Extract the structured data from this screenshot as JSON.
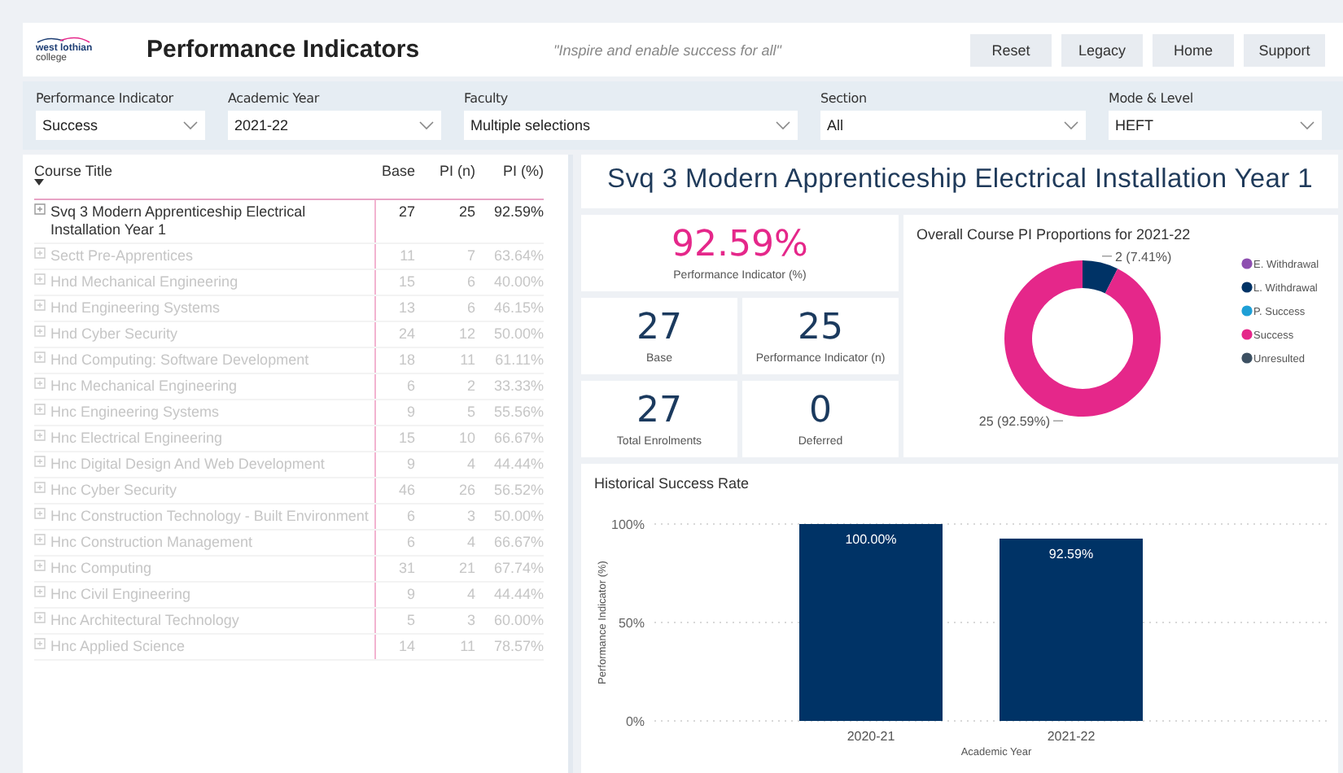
{
  "header": {
    "logo": [
      "west lothian",
      "college"
    ],
    "title": "Performance Indicators",
    "tagline": "\"Inspire and enable success for all\"",
    "buttons": [
      "Reset",
      "Legacy",
      "Home",
      "Support"
    ]
  },
  "filters": [
    {
      "label": "Performance Indicator",
      "value": "Success"
    },
    {
      "label": "Academic Year",
      "value": "2021-22"
    },
    {
      "label": "Faculty",
      "value": "Multiple selections"
    },
    {
      "label": "Section",
      "value": "All"
    },
    {
      "label": "Mode & Level",
      "value": "HEFT"
    }
  ],
  "table": {
    "columns": [
      "Course Title",
      "Base",
      "PI (n)",
      "PI (%)"
    ],
    "rows": [
      {
        "title": "Svq 3 Modern Apprenticeship Electrical Installation Year 1",
        "base": "27",
        "pi_n": "25",
        "pi_pct": "92.59%",
        "selected": true
      },
      {
        "title": "Sectt Pre-Apprentices",
        "base": "11",
        "pi_n": "7",
        "pi_pct": "63.64%",
        "selected": false
      },
      {
        "title": "Hnd Mechanical Engineering",
        "base": "15",
        "pi_n": "6",
        "pi_pct": "40.00%",
        "selected": false
      },
      {
        "title": "Hnd Engineering Systems",
        "base": "13",
        "pi_n": "6",
        "pi_pct": "46.15%",
        "selected": false
      },
      {
        "title": "Hnd Cyber Security",
        "base": "24",
        "pi_n": "12",
        "pi_pct": "50.00%",
        "selected": false
      },
      {
        "title": "Hnd Computing: Software Development",
        "base": "18",
        "pi_n": "11",
        "pi_pct": "61.11%",
        "selected": false
      },
      {
        "title": "Hnc Mechanical Engineering",
        "base": "6",
        "pi_n": "2",
        "pi_pct": "33.33%",
        "selected": false
      },
      {
        "title": "Hnc Engineering Systems",
        "base": "9",
        "pi_n": "5",
        "pi_pct": "55.56%",
        "selected": false
      },
      {
        "title": "Hnc Electrical Engineering",
        "base": "15",
        "pi_n": "10",
        "pi_pct": "66.67%",
        "selected": false
      },
      {
        "title": "Hnc Digital Design And Web Development",
        "base": "9",
        "pi_n": "4",
        "pi_pct": "44.44%",
        "selected": false
      },
      {
        "title": "Hnc Cyber Security",
        "base": "46",
        "pi_n": "26",
        "pi_pct": "56.52%",
        "selected": false
      },
      {
        "title": "Hnc Construction Technology - Built Environment",
        "base": "6",
        "pi_n": "3",
        "pi_pct": "50.00%",
        "selected": false
      },
      {
        "title": "Hnc Construction Management",
        "base": "6",
        "pi_n": "4",
        "pi_pct": "66.67%",
        "selected": false
      },
      {
        "title": "Hnc Computing",
        "base": "31",
        "pi_n": "21",
        "pi_pct": "67.74%",
        "selected": false
      },
      {
        "title": "Hnc Civil Engineering",
        "base": "9",
        "pi_n": "4",
        "pi_pct": "44.44%",
        "selected": false
      },
      {
        "title": "Hnc Architectural Technology",
        "base": "5",
        "pi_n": "3",
        "pi_pct": "60.00%",
        "selected": false
      },
      {
        "title": "Hnc Applied Science",
        "base": "14",
        "pi_n": "11",
        "pi_pct": "78.57%",
        "selected": false
      }
    ]
  },
  "course_title": "Svq 3 Modern Apprenticeship Electrical Installation Year 1",
  "kpis": [
    {
      "value": "92.59%",
      "label": "Performance Indicator (%)",
      "kind": "highlight"
    },
    {
      "value": "27",
      "label": "Base",
      "kind": "plain"
    },
    {
      "value": "25",
      "label": "Performance Indicator (n)",
      "kind": "plain"
    },
    {
      "value": "27",
      "label": "Total Enrolments",
      "kind": "plain"
    },
    {
      "value": "0",
      "label": "Deferred",
      "kind": "plain"
    }
  ],
  "proportions": {
    "title": "Overall Course PI Proportions for 2021-22",
    "chart_data": {
      "type": "donut",
      "categories": [
        "E. Withdrawal",
        "L. Withdrawal",
        "P. Success",
        "Success",
        "Unresulted"
      ],
      "values": [
        0,
        7.41,
        0,
        92.59,
        0
      ],
      "value_labels": [
        null,
        "2 (7.41%)",
        null,
        "25 (92.59%)",
        null
      ],
      "legend": "right"
    },
    "legend": [
      {
        "color": "#8e4fb0"
      },
      {
        "color": "#003366"
      },
      {
        "color": "#1e9fd6"
      },
      {
        "color": "#e5278a"
      },
      {
        "color": "#3c5062"
      }
    ]
  },
  "history": {
    "title": "Historical Success Rate",
    "chart_data": {
      "type": "bar",
      "xlabel": "Academic Year",
      "ylabel": "Performance Indicator (%)",
      "categories": [
        "2020-21",
        "2021-22"
      ],
      "series": [
        {
          "color": "#003366",
          "values": [
            100,
            92.59
          ]
        }
      ],
      "ylim": [
        0,
        100
      ],
      "yticks": [
        {
          "value": 0,
          "label": "0%"
        },
        {
          "value": 50,
          "label": "50%"
        },
        {
          "value": 100,
          "label": "100%"
        }
      ],
      "value_labels": [
        "100.00%",
        "92.59%"
      ]
    }
  }
}
